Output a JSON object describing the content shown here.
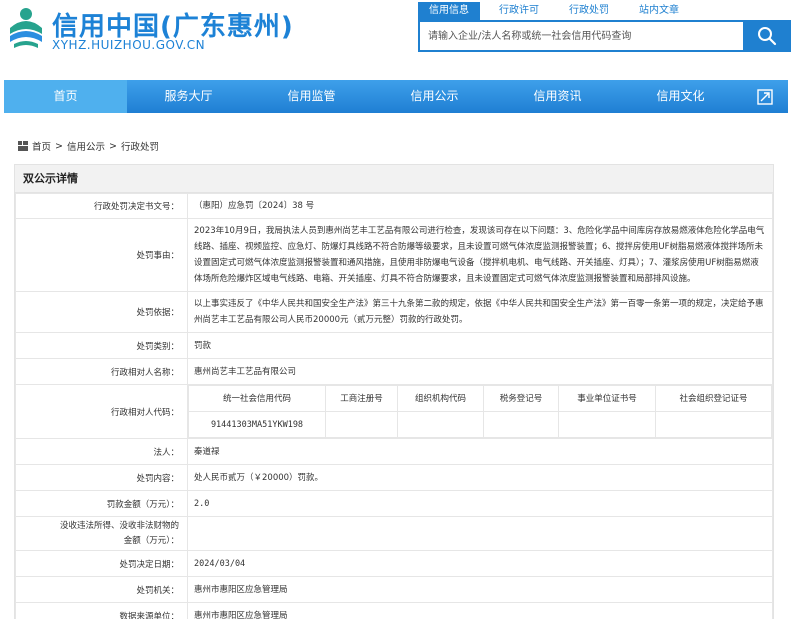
{
  "header": {
    "title": "信用中国(广东惠州)",
    "url": "XYHZ.HUIZHOU.GOV.CN"
  },
  "search": {
    "tabs": [
      "信用信息",
      "行政许可",
      "行政处罚",
      "站内文章"
    ],
    "placeholder": "请输入企业/法人名称或统一社会信用代码查询"
  },
  "nav": {
    "items": [
      "首页",
      "服务大厅",
      "信用监管",
      "信用公示",
      "信用资讯",
      "信用文化"
    ]
  },
  "breadcrumb": [
    "首页",
    "信用公示",
    "行政处罚"
  ],
  "panel_title": "双公示详情",
  "detail": {
    "doc_no_label": "行政处罚决定书文号：",
    "doc_no": "（惠阳）应急罚〔2024〕38 号",
    "reason_label": "处罚事由：",
    "reason": "2023年10月9日，我局执法人员到惠州尚艺丰工艺品有限公司进行检查，发现该司存在以下问题：3、危险化学品中间库房存放易燃液体危险化学品电气线路、插座、视频监控、应急灯、防爆灯具线路不符合防爆等级要求，且未设置可燃气体浓度监测报警装置；6、搅拌房使用UF树脂易燃液体搅拌场所未设置固定式可燃气体浓度监测报警装置和通风措施，且使用非防爆电气设备（搅拌机电机、电气线路、开关插座、灯具）；7、灌浆房使用UF树脂易燃液体场所危险爆炸区域电气线路、电箱、开关插座、灯具不符合防爆要求，且未设置固定式可燃气体浓度监测报警装置和局部排风设施。",
    "basis_label": "处罚依据：",
    "basis": "以上事实违反了《中华人民共和国安全生产法》第三十九条第二款的规定，依据《中华人民共和国安全生产法》第一百零一条第一项的规定，决定给予惠州尚艺丰工艺品有限公司人民币20000元（贰万元整）罚款的行政处罚。",
    "type_label": "处罚类别：",
    "type": "罚款",
    "party_label": "行政相对人名称：",
    "party": "惠州尚艺丰工艺品有限公司",
    "code_label": "行政相对人代码：",
    "code_headers": [
      "统一社会信用代码",
      "工商注册号",
      "组织机构代码",
      "税务登记号",
      "事业单位证书号",
      "社会组织登记证号"
    ],
    "code_values": [
      "91441303MA51YKW198",
      "",
      "",
      "",
      "",
      ""
    ],
    "legal_label": "法人：",
    "legal": "秦道禄",
    "content_label": "处罚内容：",
    "content": "处人民币贰万（￥20000）罚款。",
    "amount_label": "罚款金额（万元）：",
    "amount": "2.0",
    "confiscate_label": "没收违法所得、没收非法财物的金额（万元）：",
    "confiscate": "",
    "date_label": "处罚决定日期：",
    "date": "2024/03/04",
    "agency_label": "处罚机关：",
    "agency": "惠州市惠阳区应急管理局",
    "source_label": "数据来源单位：",
    "source": "惠州市惠阳区应急管理局"
  },
  "colors": {
    "brand_blue": "#1d82d6",
    "nav_blue": "#2b8ee0",
    "logo_teal": "#27a38e"
  },
  "icons": [
    "site-logo-icon",
    "search-icon",
    "expand-icon",
    "breadcrumb-home-icon"
  ]
}
